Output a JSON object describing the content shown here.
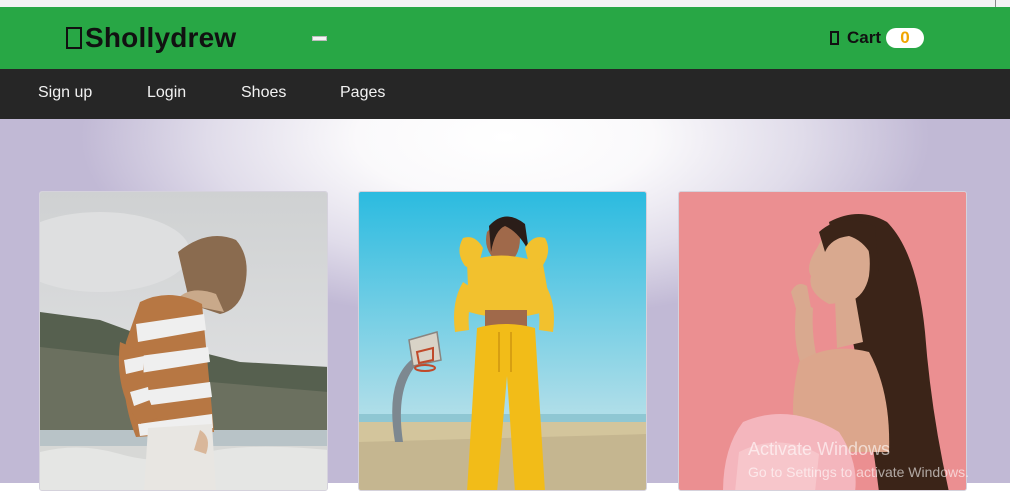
{
  "brand": {
    "name": "Shollydrew",
    "icon": "brand-glyph-icon"
  },
  "header": {
    "cart_label": "Cart",
    "cart_count": "0",
    "cart_icon": "cart-icon"
  },
  "nav": {
    "items": [
      "Sign up",
      "Login",
      "Shoes",
      "Pages"
    ]
  },
  "products": [
    {
      "image": "woman-striped-sweater-photo"
    },
    {
      "image": "woman-yellow-tracksuit-photo"
    },
    {
      "image": "woman-pink-background-photo"
    }
  ],
  "watermark": {
    "title": "Activate Windows",
    "subtitle": "Go to Settings to activate Windows."
  },
  "colors": {
    "header": "#28a745",
    "nav": "#262626",
    "badge_text": "#f0a500"
  }
}
